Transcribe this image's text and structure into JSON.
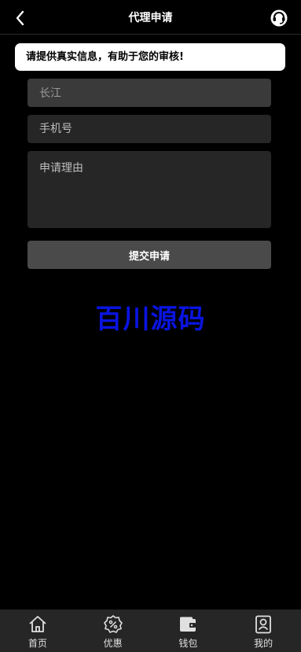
{
  "header": {
    "title": "代理申请",
    "back_icon": "chevron-left-icon",
    "support_icon": "headset-icon"
  },
  "notice": {
    "text": "请提供真实信息，有助于您的审核!"
  },
  "form": {
    "name_value": "长江",
    "phone_placeholder": "手机号",
    "reason_placeholder": "申请理由",
    "submit_label": "提交申请"
  },
  "watermark": {
    "text": "百川源码",
    "color": "#0a14e0"
  },
  "tabbar": {
    "items": [
      {
        "label": "首页",
        "icon": "home-icon"
      },
      {
        "label": "优惠",
        "icon": "discount-icon"
      },
      {
        "label": "钱包",
        "icon": "wallet-icon"
      },
      {
        "label": "我的",
        "icon": "profile-icon"
      }
    ]
  }
}
